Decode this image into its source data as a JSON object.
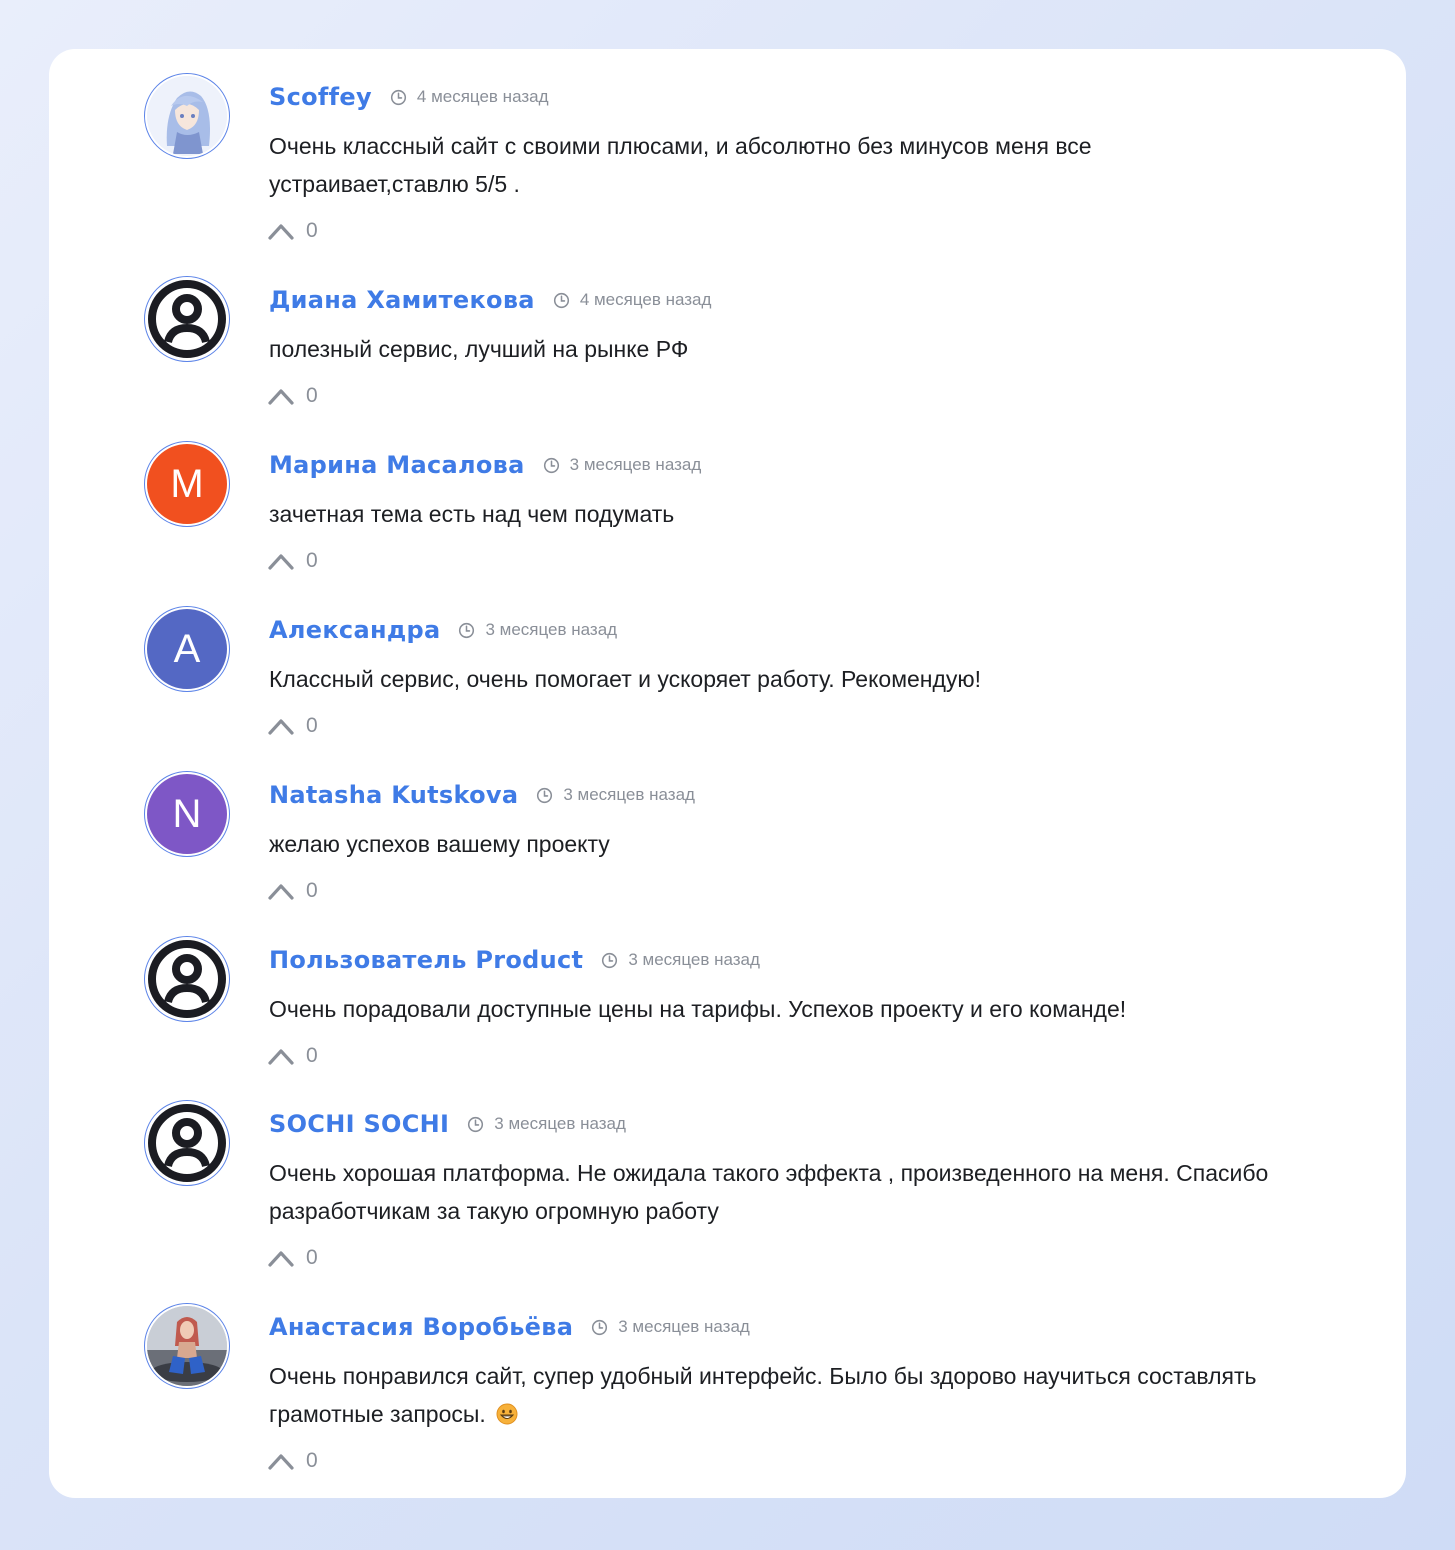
{
  "comments": [
    {
      "author": "Scoffey",
      "time": "4 месяцев назад",
      "text": "Очень классный сайт с своими плюсами, и абсолютно без минусов меня все устраивает,ставлю 5/5 .",
      "votes": "0",
      "avatar": {
        "type": "image",
        "icon": "anime-avatar-image"
      }
    },
    {
      "author": "Диана Хамитекова",
      "time": "4 месяцев назад",
      "text": "полезный сервис, лучший на рынке РФ",
      "votes": "0",
      "avatar": {
        "type": "default",
        "icon": "user-icon"
      }
    },
    {
      "author": "Марина Масалова",
      "time": "3 месяцев назад",
      "text": "зачетная тема есть над чем подумать",
      "votes": "0",
      "avatar": {
        "type": "letter",
        "letter": "M",
        "color": "#f1501f"
      }
    },
    {
      "author": "Александра",
      "time": "3 месяцев назад",
      "text": "Классный сервис, очень помогает и ускоряет работу. Рекомендую!",
      "votes": "0",
      "avatar": {
        "type": "letter",
        "letter": "A",
        "color": "#5468c4"
      }
    },
    {
      "author": "Natasha Kutskova",
      "time": "3 месяцев назад",
      "text": "желаю успехов вашему проекту",
      "votes": "0",
      "avatar": {
        "type": "letter",
        "letter": "N",
        "color": "#7e57c6"
      }
    },
    {
      "author": "Пользователь Product",
      "time": "3 месяцев назад",
      "text": "Очень порадовали доступные цены на тарифы. Успехов проекту и его команде!",
      "votes": "0",
      "avatar": {
        "type": "default",
        "icon": "user-icon"
      }
    },
    {
      "author": "SOCHI SOCHI",
      "time": "3 месяцев назад",
      "text": "Очень хорошая платформа. Не ожидала такого эффекта , произведенного на меня. Спасибо разработчикам за такую огромную работу",
      "votes": "0",
      "avatar": {
        "type": "default",
        "icon": "user-icon"
      }
    },
    {
      "author": "Анастасия Воробьёва",
      "time": "3 месяцев назад",
      "text": "Очень понравился сайт, супер удобный интерфейс. Было бы здорово научиться составлять грамотные запросы.",
      "votes": "0",
      "avatar": {
        "type": "image",
        "icon": "photo-avatar-image"
      },
      "emoji": "grinning-face-emoji"
    }
  ],
  "colors": {
    "accent": "#3f7be6",
    "muted": "#8a8f98",
    "text": "#1d1f23"
  }
}
